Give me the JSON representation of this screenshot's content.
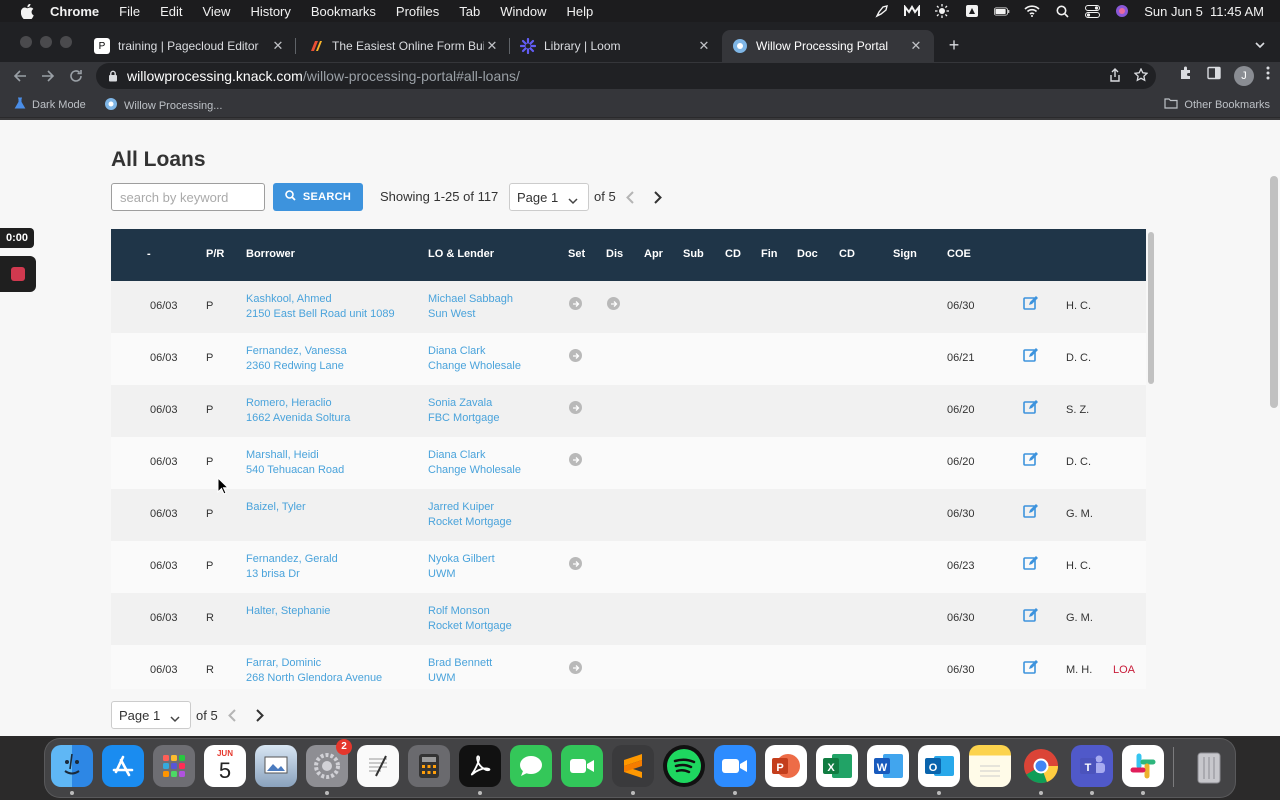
{
  "menubar": {
    "items": [
      "Chrome",
      "File",
      "Edit",
      "View",
      "History",
      "Bookmarks",
      "Profiles",
      "Tab",
      "Window",
      "Help"
    ],
    "datetime": "Sun Jun 5  11:45 AM"
  },
  "tabs": [
    {
      "title": "training | Pagecloud Editor",
      "icon": "pagecloud-icon",
      "color": "#ffffff"
    },
    {
      "title": "The Easiest Online Form Builder",
      "icon": "formbuilder-icon",
      "color": "#e94f35"
    },
    {
      "title": "Library | Loom",
      "icon": "loom-icon",
      "color": "#625df5"
    },
    {
      "title": "Willow Processing Portal",
      "icon": "knack-icon",
      "color": "#7fb6e6"
    }
  ],
  "address": {
    "host": "willowprocessing.knack.com",
    "path": "/willow-processing-portal#all-loans/"
  },
  "profile_initial": "J",
  "bookmarks": {
    "items": [
      "Dark Mode",
      "Willow Processing..."
    ],
    "other": "Other Bookmarks"
  },
  "loom": {
    "timer": "0:00"
  },
  "page": {
    "title": "All Loans",
    "search_placeholder": "search by keyword",
    "search_button": "SEARCH",
    "showing": "Showing 1-25 of 117",
    "page_select": "Page 1",
    "of_pages": "of 5"
  },
  "table": {
    "headers": [
      "-",
      "P/R",
      "Borrower",
      "LO & Lender",
      "Set",
      "Dis",
      "Apr",
      "Sub",
      "CD",
      "Fin",
      "Doc",
      "CD",
      "Sign",
      "COE"
    ],
    "rows": [
      {
        "date": "06/03",
        "pr": "P",
        "borrower": "Kashkool, Ahmed",
        "address": "2150 East Bell Road unit 1089",
        "lo": "Michael Sabbagh",
        "lender": "Sun West",
        "set": true,
        "dis": true,
        "coe": "06/30",
        "initials": "H. C.",
        "flag": ""
      },
      {
        "date": "06/03",
        "pr": "P",
        "borrower": "Fernandez, Vanessa",
        "address": "2360 Redwing Lane",
        "lo": "Diana Clark",
        "lender": "Change Wholesale",
        "set": true,
        "dis": false,
        "coe": "06/21",
        "initials": "D. C.",
        "flag": ""
      },
      {
        "date": "06/03",
        "pr": "P",
        "borrower": "Romero, Heraclio",
        "address": "1662 Avenida Soltura",
        "lo": "Sonia Zavala",
        "lender": "FBC Mortgage",
        "set": true,
        "dis": false,
        "coe": "06/20",
        "initials": "S. Z.",
        "flag": ""
      },
      {
        "date": "06/03",
        "pr": "P",
        "borrower": "Marshall, Heidi",
        "address": "540 Tehuacan Road",
        "lo": "Diana Clark",
        "lender": "Change Wholesale",
        "set": true,
        "dis": false,
        "coe": "06/20",
        "initials": "D. C.",
        "flag": ""
      },
      {
        "date": "06/03",
        "pr": "P",
        "borrower": "Baizel, Tyler",
        "address": "",
        "lo": "Jarred Kuiper",
        "lender": "Rocket Mortgage",
        "set": false,
        "dis": false,
        "coe": "06/30",
        "initials": "G. M.",
        "flag": ""
      },
      {
        "date": "06/03",
        "pr": "P",
        "borrower": "Fernandez, Gerald",
        "address": "13 brisa Dr",
        "lo": "Nyoka Gilbert",
        "lender": "UWM",
        "set": true,
        "dis": false,
        "coe": "06/23",
        "initials": "H. C.",
        "flag": ""
      },
      {
        "date": "06/03",
        "pr": "R",
        "borrower": "Halter, Stephanie",
        "address": "",
        "lo": "Rolf Monson",
        "lender": "Rocket Mortgage",
        "set": false,
        "dis": false,
        "coe": "06/30",
        "initials": "G. M.",
        "flag": ""
      },
      {
        "date": "06/03",
        "pr": "R",
        "borrower": "Farrar, Dominic",
        "address": "268 North Glendora Avenue",
        "lo": "Brad Bennett",
        "lender": "UWM",
        "set": true,
        "dis": false,
        "coe": "06/30",
        "initials": "M. H.",
        "flag": "LOA"
      }
    ]
  },
  "dock": {
    "calendar_month": "JUN",
    "calendar_day": "5",
    "settings_badge": "2",
    "apps": [
      "finder-icon",
      "app-store-icon",
      "launchpad-icon",
      "calendar-icon",
      "preview-icon",
      "system-preferences-icon",
      "textedit-icon",
      "calculator-icon",
      "acrobat-icon",
      "messages-icon",
      "facetime-icon",
      "sublime-text-icon",
      "spotify-icon",
      "zoom-icon",
      "powerpoint-icon",
      "excel-icon",
      "word-icon",
      "outlook-icon",
      "notes-icon",
      "chrome-icon",
      "teams-icon",
      "slack-icon",
      "trash-icon"
    ]
  }
}
